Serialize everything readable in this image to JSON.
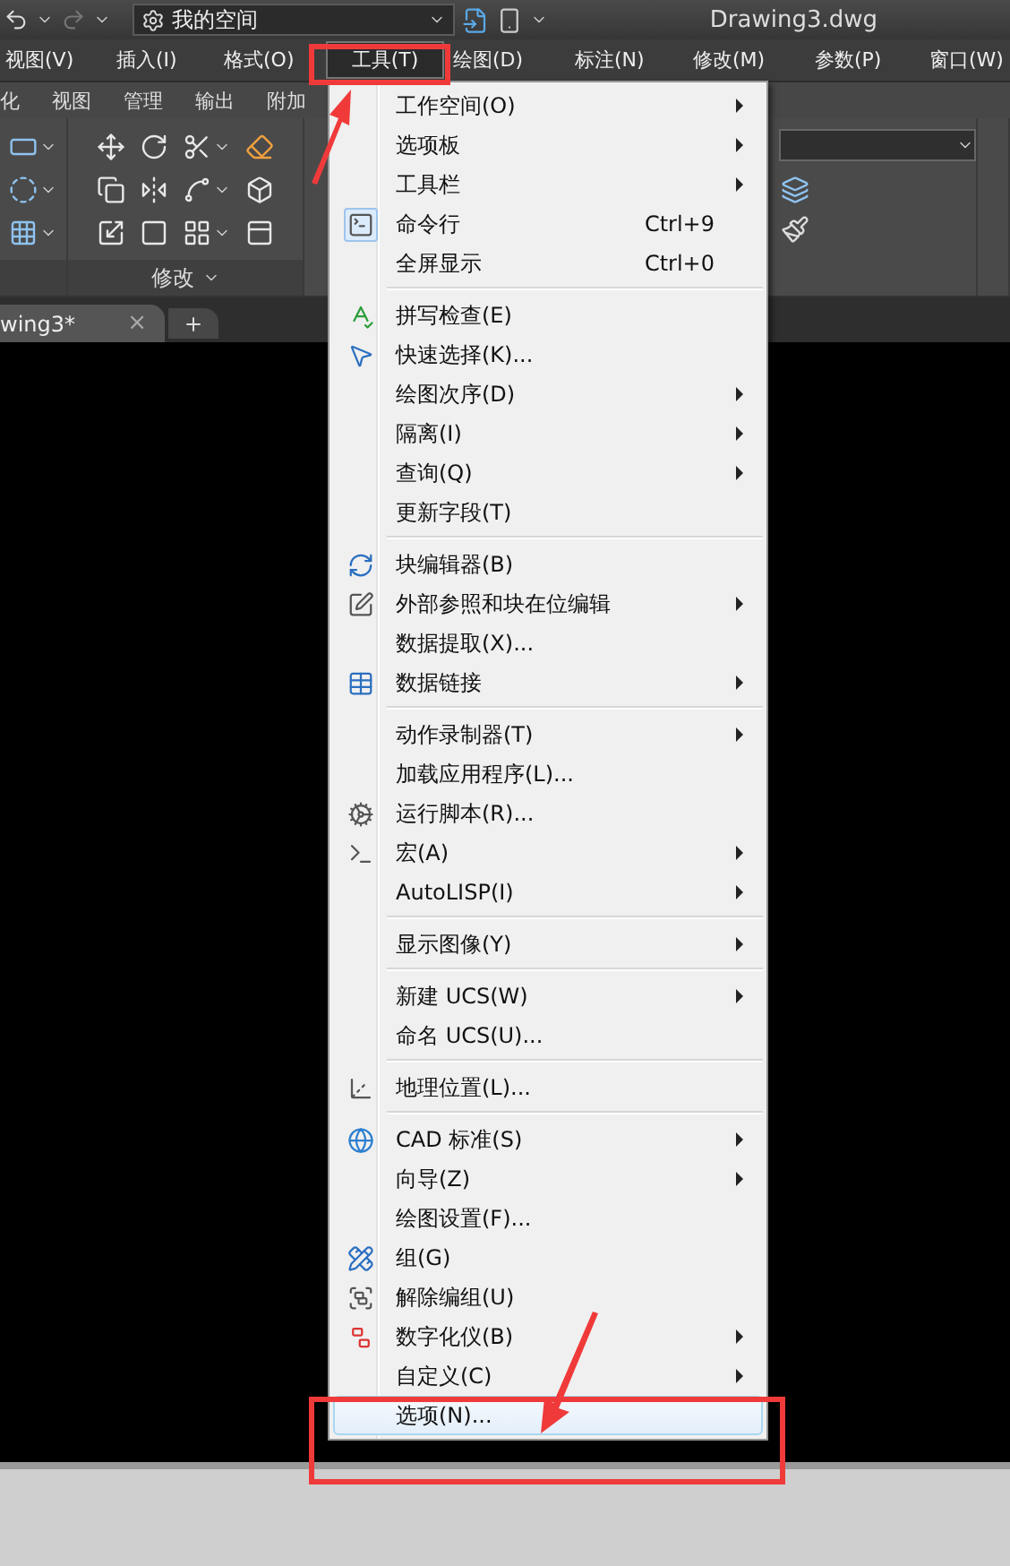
{
  "title_bar": {
    "workspace": "我的空间",
    "title": "Drawing3.dwg"
  },
  "menu_bar": [
    {
      "label": "视图(V)",
      "selected": false
    },
    {
      "label": "插入(I)",
      "selected": false
    },
    {
      "label": "格式(O)",
      "selected": false
    },
    {
      "label": "工具(T)",
      "selected": true
    },
    {
      "label": "绘图(D)",
      "selected": false
    },
    {
      "label": "标注(N)",
      "selected": false
    },
    {
      "label": "修改(M)",
      "selected": false
    },
    {
      "label": "参数(P)",
      "selected": false
    },
    {
      "label": "窗口(W)",
      "selected": false
    }
  ],
  "ribbon_tabs": [
    "化",
    "视图",
    "管理",
    "输出",
    "附加"
  ],
  "ribbon": {
    "panel_title": "修改"
  },
  "document_tabs": [
    {
      "label": "wing3*",
      "close": "×"
    }
  ],
  "tools_menu": {
    "sections": [
      [
        {
          "label": "工作空间(O)",
          "submenu": true,
          "checked": false,
          "selected": false
        },
        {
          "label": "选项板",
          "submenu": true,
          "checked": false,
          "selected": false
        },
        {
          "label": "工具栏",
          "submenu": true,
          "checked": false,
          "selected": false
        },
        {
          "label": "命令行",
          "shortcut": "Ctrl+9",
          "submenu": false,
          "checked": true,
          "selected": false
        },
        {
          "label": "全屏显示",
          "shortcut": "Ctrl+0",
          "submenu": false,
          "checked": false,
          "selected": false
        }
      ],
      [
        {
          "label": "拼写检查(E)",
          "submenu": false,
          "checked": false,
          "selected": false
        },
        {
          "label": "快速选择(K)...",
          "submenu": false,
          "checked": false,
          "selected": false
        },
        {
          "label": "绘图次序(D)",
          "submenu": true,
          "checked": false,
          "selected": false
        },
        {
          "label": "隔离(I)",
          "submenu": true,
          "checked": false,
          "selected": false
        },
        {
          "label": "查询(Q)",
          "submenu": true,
          "checked": false,
          "selected": false
        },
        {
          "label": "更新字段(T)",
          "submenu": false,
          "checked": false,
          "selected": false
        }
      ],
      [
        {
          "label": "块编辑器(B)",
          "submenu": false,
          "checked": false,
          "selected": false
        },
        {
          "label": "外部参照和块在位编辑",
          "submenu": true,
          "checked": false,
          "selected": false
        },
        {
          "label": "数据提取(X)...",
          "submenu": false,
          "checked": false,
          "selected": false
        },
        {
          "label": "数据链接",
          "submenu": true,
          "checked": false,
          "selected": false
        }
      ],
      [
        {
          "label": "动作录制器(T)",
          "submenu": true,
          "checked": false,
          "selected": false
        },
        {
          "label": "加载应用程序(L)...",
          "submenu": false,
          "checked": false,
          "selected": false
        },
        {
          "label": "运行脚本(R)...",
          "submenu": false,
          "checked": false,
          "selected": false
        },
        {
          "label": "宏(A)",
          "submenu": true,
          "checked": false,
          "selected": false
        },
        {
          "label": "AutoLISP(I)",
          "submenu": true,
          "checked": false,
          "selected": false
        }
      ],
      [
        {
          "label": "显示图像(Y)",
          "submenu": true,
          "checked": false,
          "selected": false
        }
      ],
      [
        {
          "label": "新建 UCS(W)",
          "submenu": true,
          "checked": false,
          "selected": false
        },
        {
          "label": "命名 UCS(U)...",
          "submenu": false,
          "checked": false,
          "selected": false
        }
      ],
      [
        {
          "label": "地理位置(L)...",
          "submenu": false,
          "checked": false,
          "selected": false
        }
      ],
      [
        {
          "label": "CAD 标准(S)",
          "submenu": true,
          "checked": false,
          "selected": false
        },
        {
          "label": "向导(Z)",
          "submenu": true,
          "checked": false,
          "selected": false
        },
        {
          "label": "绘图设置(F)...",
          "submenu": false,
          "checked": false,
          "selected": false
        },
        {
          "label": "组(G)",
          "submenu": false,
          "checked": false,
          "selected": false
        },
        {
          "label": "解除编组(U)",
          "submenu": false,
          "checked": false,
          "selected": false
        },
        {
          "label": "数字化仪(B)",
          "submenu": true,
          "checked": false,
          "selected": false
        },
        {
          "label": "自定义(C)",
          "submenu": true,
          "checked": false,
          "selected": false
        },
        {
          "label": "选项(N)...",
          "submenu": false,
          "checked": false,
          "selected": true
        }
      ]
    ]
  }
}
